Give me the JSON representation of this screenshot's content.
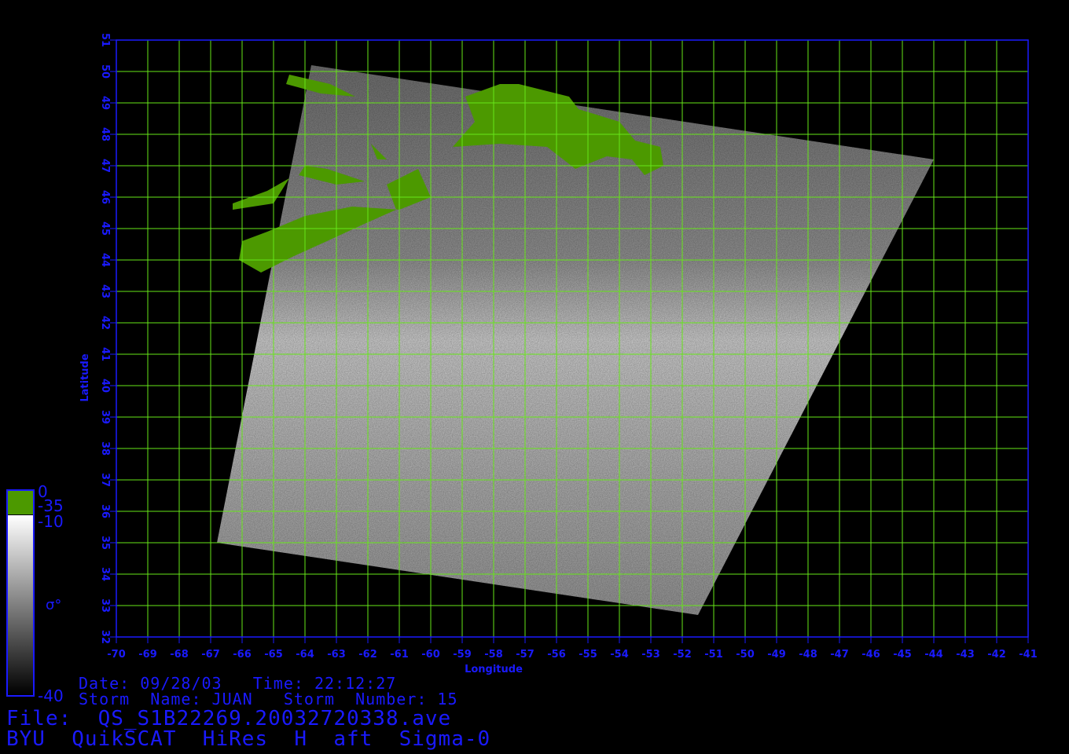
{
  "map": {
    "axes": {
      "x_label": "Longitude",
      "y_label": "Latitude",
      "lon_range": [
        -70,
        -41
      ],
      "lat_range": [
        32,
        51
      ],
      "lon_ticks": [
        "-70",
        "-69",
        "-68",
        "-67",
        "-66",
        "-65",
        "-64",
        "-63",
        "-62",
        "-61",
        "-60",
        "-59",
        "-58",
        "-57",
        "-56",
        "-55",
        "-54",
        "-53",
        "-52",
        "-51",
        "-50",
        "-49",
        "-48",
        "-47",
        "-46",
        "-45",
        "-44",
        "-43",
        "-42",
        "-41"
      ],
      "lat_ticks": [
        "32",
        "33",
        "34",
        "35",
        "36",
        "37",
        "38",
        "39",
        "40",
        "41",
        "42",
        "43",
        "44",
        "45",
        "46",
        "47",
        "48",
        "49",
        "50",
        "51"
      ],
      "grid": true
    },
    "swath_corners_lonlat": [
      [
        -63.8,
        50.2
      ],
      [
        -44.0,
        47.2
      ],
      [
        -51.5,
        32.7
      ],
      [
        -66.8,
        35.0
      ]
    ],
    "colors": {
      "axis": "#1a1aff",
      "grid": "#66e619",
      "land": "#4c9900",
      "background": "#000000"
    }
  },
  "colorbar": {
    "land_top": "0",
    "land_bottom": "-35",
    "sigma_top": "-10",
    "sigma_bottom": "-40",
    "symbol": "σ°"
  },
  "info": {
    "date_time": "Date: 09/28/03   Time: 22:12:27",
    "storm": "Storm  Name: JUAN   Storm  Number: 15"
  },
  "footer": {
    "file": "File:  QS_S1B22269.20032720338.ave",
    "product": "BYU  QuikSCAT  HiRes  H  aft  Sigma-0"
  }
}
